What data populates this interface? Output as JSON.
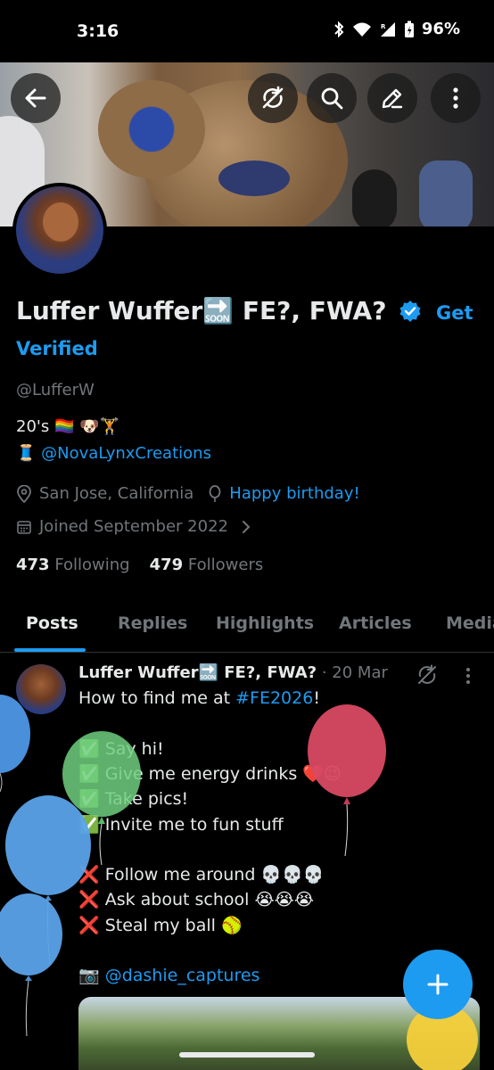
{
  "status_bar": {
    "time": "3:16",
    "battery": "96%"
  },
  "profile": {
    "display_name": "Luffer Wuffer🔜 FE?, FWA?",
    "get_verified": "Get Verified",
    "handle": "@LufferW",
    "bio_line1": "20's 🏳️‍🌈 🐶🏋",
    "bio_line2_prefix": "🧵",
    "bio_link": "@NovaLynxCreations",
    "location": "San Jose, California",
    "birthday": "Happy birthday!",
    "joined": "Joined September 2022",
    "following_count": "473",
    "following_label": "Following",
    "followers_count": "479",
    "followers_label": "Followers"
  },
  "tabs": [
    {
      "label": "Posts"
    },
    {
      "label": "Replies"
    },
    {
      "label": "Highlights"
    },
    {
      "label": "Articles"
    },
    {
      "label": "Media"
    }
  ],
  "post": {
    "name": "Luffer Wuffer🔜 FE?, FWA?",
    "dot": "·",
    "date": "20 Mar",
    "line1_prefix": "How to find me at ",
    "hashtag": "#FE2026",
    "line1_suffix": "!",
    "lines": [
      "✅ Say hi!",
      "✅ Give me energy drinks ❤️😉",
      "✅ Take pics!",
      "✅ Invite me to fun stuff",
      "❌ Follow me around 💀💀💀",
      "❌ Ask about school 😭😭😭",
      "❌ Steal my ball 🥎"
    ],
    "credit_prefix": "📷 ",
    "credit_link": "@dashie_captures"
  },
  "colors": {
    "accent": "#1d9bf0",
    "background": "#000000",
    "text_primary": "#e7e9ea",
    "text_secondary": "#71767b"
  },
  "icons": {
    "back": "arrow-left-icon",
    "sync": "sync-icon",
    "search": "search-icon",
    "edit": "pencil-icon",
    "more": "more-vertical-icon"
  }
}
